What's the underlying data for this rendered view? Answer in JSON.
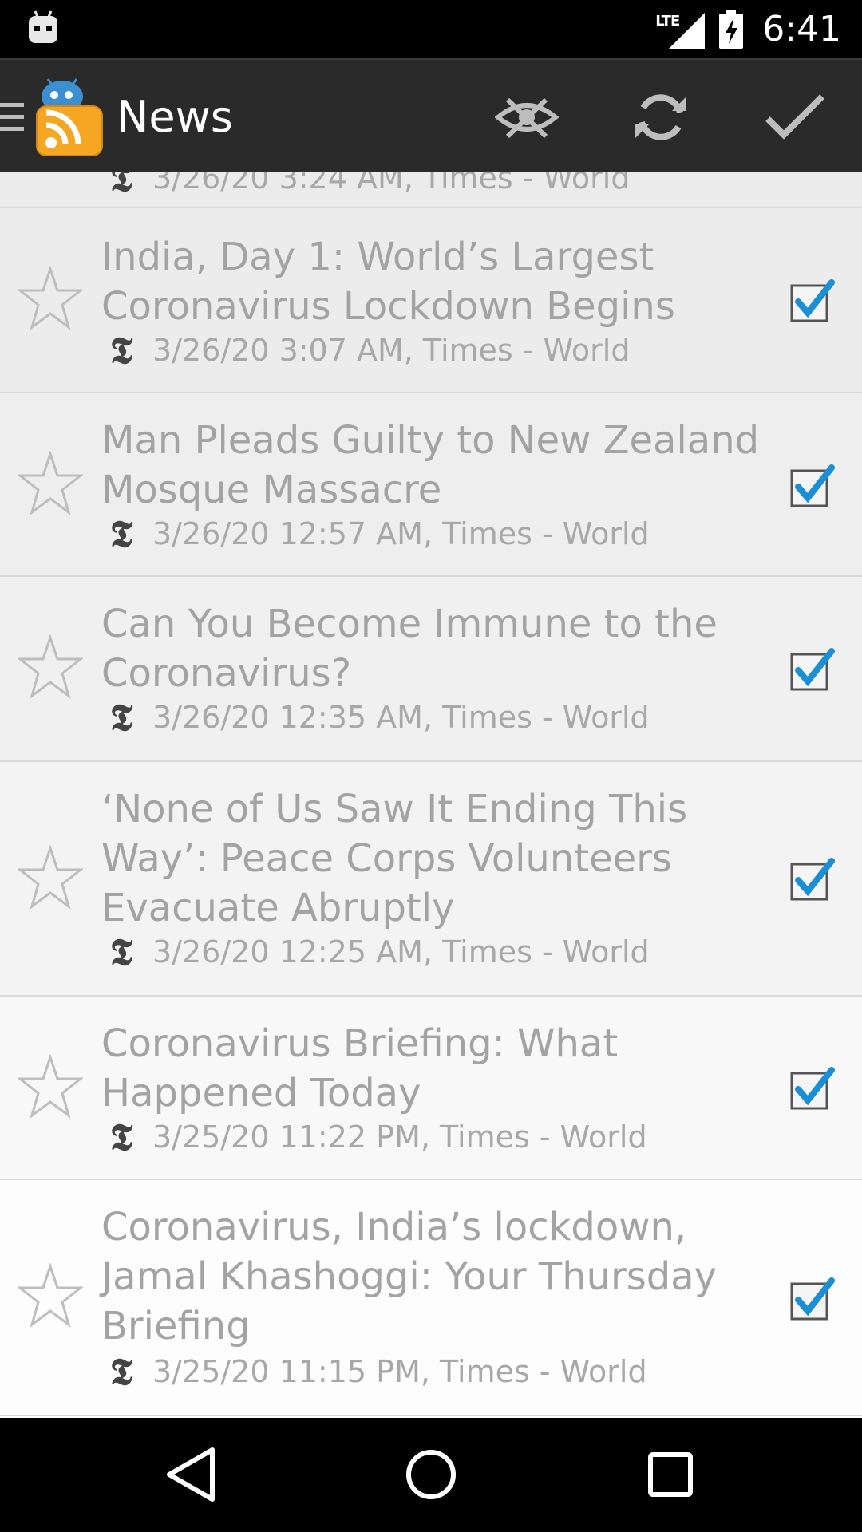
{
  "status_bar": {
    "network": "LTE",
    "time": "6:41"
  },
  "action_bar": {
    "title": "News",
    "icons": [
      "drawer-icon",
      "app-logo",
      "hide-read-icon",
      "refresh-icon",
      "mark-all-read-icon"
    ]
  },
  "partial_item": {
    "meta": "3/26/20 3:24 AM, Times - World"
  },
  "items": [
    {
      "title": "India, Day 1: World’s Largest Coronavirus Lockdown Begins",
      "meta": "3/26/20 3:07 AM, Times - World",
      "checked": true,
      "starred": false
    },
    {
      "title": "Man Pleads Guilty to New Zealand Mosque Massacre",
      "meta": "3/26/20 12:57 AM, Times - World",
      "checked": true,
      "starred": false
    },
    {
      "title": "Can You Become Immune to the Coronavirus?",
      "meta": "3/26/20 12:35 AM, Times - World",
      "checked": true,
      "starred": false
    },
    {
      "title": "‘None of Us Saw It Ending This Way’: Peace Corps Volunteers Evacuate Abruptly",
      "meta": "3/26/20 12:25 AM, Times - World",
      "checked": true,
      "starred": false
    },
    {
      "title": "Coronavirus Briefing: What Happened Today",
      "meta": "3/25/20 11:22 PM, Times - World",
      "checked": true,
      "starred": false
    },
    {
      "title": "Coronavirus, India’s lockdown, Jamal Khashoggi: Your Thursday Briefing",
      "meta": "3/25/20 11:15 PM, Times - World",
      "checked": true,
      "starred": false
    }
  ],
  "feed_icon_glyph": "𝕿",
  "colors": {
    "action_bar": "#2a2a2a",
    "check_blue": "#1a8fd6",
    "text_gray": "#a3a3a3"
  },
  "nav_bar": {
    "icons": [
      "back-icon",
      "home-icon",
      "recents-icon"
    ]
  }
}
